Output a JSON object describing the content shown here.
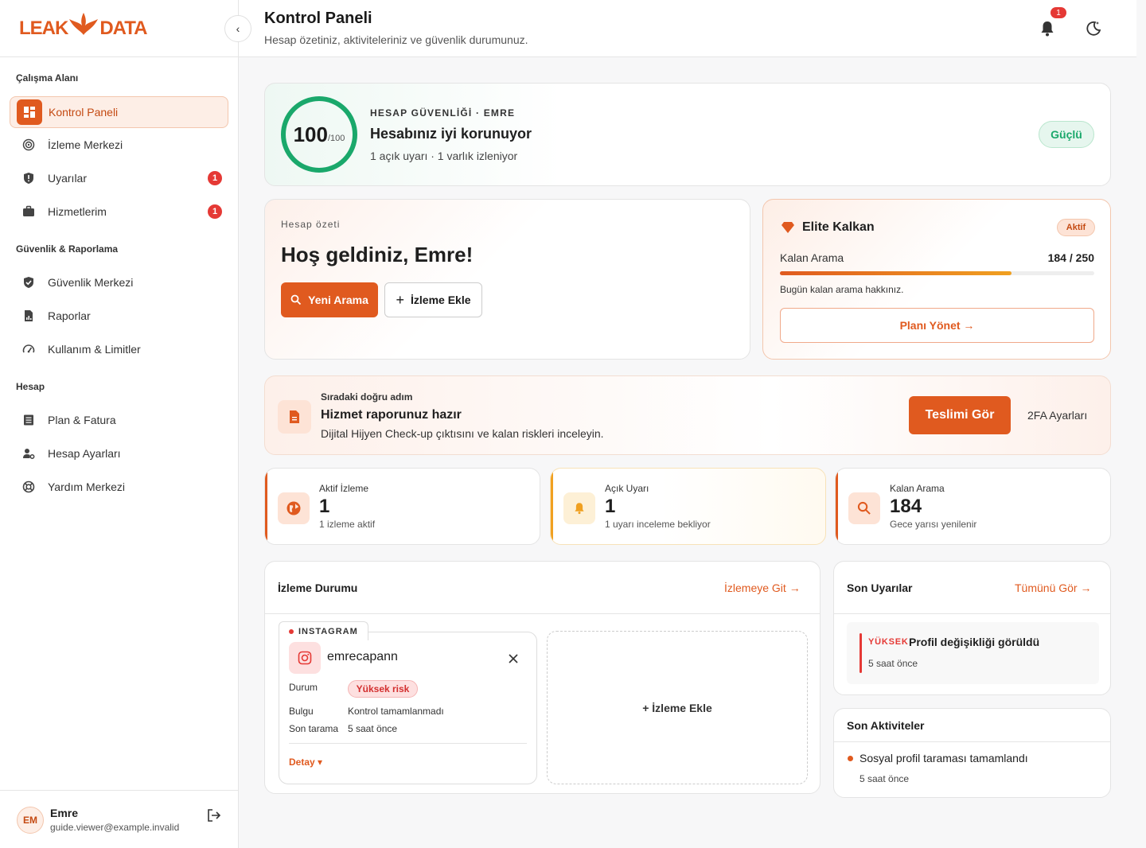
{
  "brand": {
    "name_left": "LEAK",
    "name_right": "DATA",
    "color": "#e05a1f"
  },
  "sidebar": {
    "sections": [
      {
        "title": "Çalışma Alanı",
        "items": [
          {
            "label": "Kontrol Paneli",
            "icon": "dashboard-icon",
            "active": true
          },
          {
            "label": "İzleme Merkezi",
            "icon": "radar-icon"
          },
          {
            "label": "Uyarılar",
            "icon": "shield-alert-icon",
            "badge": "1"
          },
          {
            "label": "Hizmetlerim",
            "icon": "briefcase-icon",
            "badge": "1"
          }
        ]
      },
      {
        "title": "Güvenlik & Raporlama",
        "items": [
          {
            "label": "Güvenlik Merkezi",
            "icon": "shield-check-icon"
          },
          {
            "label": "Raporlar",
            "icon": "report-icon"
          },
          {
            "label": "Kullanım & Limitler",
            "icon": "gauge-icon"
          }
        ]
      },
      {
        "title": "Hesap",
        "items": [
          {
            "label": "Plan & Fatura",
            "icon": "invoice-icon"
          },
          {
            "label": "Hesap Ayarları",
            "icon": "user-settings-icon"
          },
          {
            "label": "Yardım Merkezi",
            "icon": "lifebuoy-icon"
          }
        ]
      }
    ],
    "user": {
      "initials": "EM",
      "name": "Emre",
      "email": "guide.viewer@example.invalid"
    }
  },
  "header": {
    "title": "Kontrol Paneli",
    "subtitle": "Hesap özetiniz, aktiviteleriniz ve güvenlik durumunuz.",
    "notification_count": "1"
  },
  "security": {
    "score": "100",
    "score_max": "/100",
    "label": "HESAP GÜVENLİĞİ · EMRE",
    "title": "Hesabınız iyi korunuyor",
    "subtitle": "1 açık uyarı · 1 varlık izleniyor",
    "status": "Güçlü"
  },
  "welcome": {
    "label": "Hesap özeti",
    "title": "Hoş geldiniz, Emre!",
    "primary_button": "Yeni Arama",
    "secondary_button": "İzleme Ekle"
  },
  "plan": {
    "name": "Elite Kalkan",
    "status": "Aktif",
    "usage_label": "Kalan Arama",
    "usage_value": "184 / 250",
    "usage_fraction": 0.736,
    "note": "Bugün kalan arama hakkınız.",
    "button": "Planı Yönet →"
  },
  "next_step": {
    "label": "Sıradaki doğru adım",
    "title": "Hizmet raporunuz hazır",
    "desc": "Dijital Hijyen Check-up çıktısını ve kalan riskleri inceleyin.",
    "primary_button": "Teslimi Gör",
    "secondary_link": "2FA Ayarları"
  },
  "stats": [
    {
      "label": "Aktif İzleme",
      "value": "1",
      "sub": "1 izleme aktif",
      "color": "#e05a1f",
      "icon": "globe-icon"
    },
    {
      "label": "Açık Uyarı",
      "value": "1",
      "sub": "1 uyarı inceleme bekliyor",
      "color": "#f0a020",
      "icon": "bell-icon"
    },
    {
      "label": "Kalan Arama",
      "value": "184",
      "sub": "Gece yarısı yenilenir",
      "color": "#e05a1f",
      "icon": "search-icon"
    }
  ],
  "monitoring": {
    "title": "İzleme Durumu",
    "link": "İzlemeye Git →",
    "item": {
      "platform": "INSTAGRAM",
      "username": "emrecapann",
      "status_label": "Durum",
      "status_value": "Yüksek risk",
      "finding_label": "Bulgu",
      "finding_value": "Kontrol tamamlanmadı",
      "scan_label": "Son tarama",
      "scan_value": "5 saat önce",
      "detail": "Detay ▾"
    },
    "add_label": "+ İzleme Ekle"
  },
  "alerts": {
    "title": "Son Uyarılar",
    "link": "Tümünü Gör →",
    "items": [
      {
        "level": "YÜKSEK",
        "text": "Profil değişikliği görüldü",
        "time": "5 saat önce"
      }
    ]
  },
  "activities": {
    "title": "Son Aktiviteler",
    "items": [
      {
        "text": "Sosyal profil taraması tamamlandı",
        "time": "5 saat önce"
      }
    ]
  }
}
